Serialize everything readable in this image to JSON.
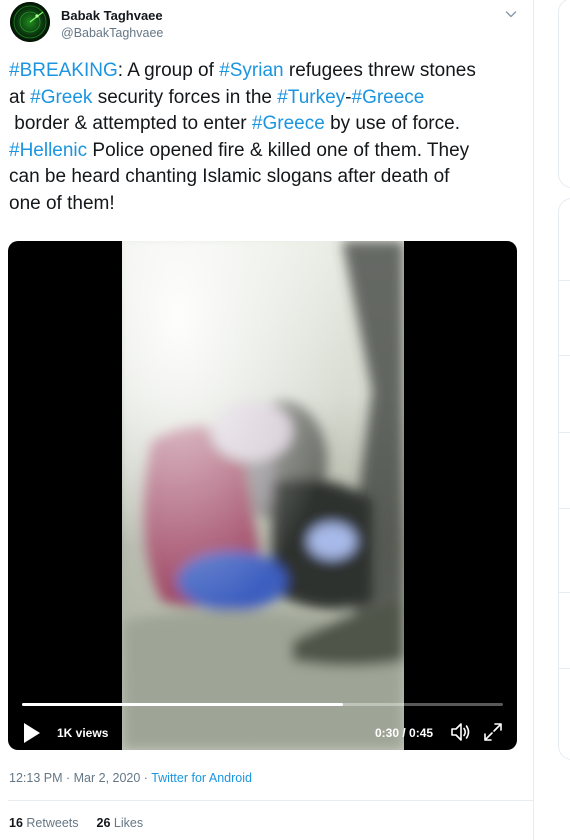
{
  "tweet": {
    "author_name": "Babak Taghvaee",
    "author_handle": "@BabakTaghvaee",
    "lines": [
      [
        {
          "t": "#BREAKING",
          "tag": true
        },
        {
          "t": ": A group of "
        },
        {
          "t": "#Syrian",
          "tag": true
        },
        {
          "t": " refugees threw stones"
        }
      ],
      [
        {
          "t": "at "
        },
        {
          "t": "#Greek",
          "tag": true
        },
        {
          "t": " security forces in the "
        },
        {
          "t": "#Turkey",
          "tag": true
        },
        {
          "t": "-"
        },
        {
          "t": "#Greece",
          "tag": true
        }
      ],
      [
        {
          "t": " border & attempted to enter "
        },
        {
          "t": "#Greece",
          "tag": true
        },
        {
          "t": " by use of force."
        }
      ],
      [
        {
          "t": "#Hellenic",
          "tag": true
        },
        {
          "t": " Police opened fire & killed one of them. They"
        }
      ],
      [
        {
          "t": "can be heard chanting Islamic slogans after death of"
        }
      ],
      [
        {
          "t": "one of them!"
        }
      ]
    ],
    "timestamp": "12:13 PM · Mar 2, 2020 · ",
    "source": "Twitter for Android",
    "retweets_count": "16",
    "retweets_label": "Retweets",
    "likes_count": "26",
    "likes_label": "Likes"
  },
  "video": {
    "views": "1K views",
    "time": "0:30 / 0:45",
    "progress_fraction": 0.667
  },
  "icons": {
    "menu": "chevron-down-icon",
    "play": "play-icon",
    "volume": "volume-icon",
    "fullscreen": "expand-icon"
  },
  "colors": {
    "link": "#1b95e0",
    "text": "#14171a",
    "muted": "#657786"
  }
}
